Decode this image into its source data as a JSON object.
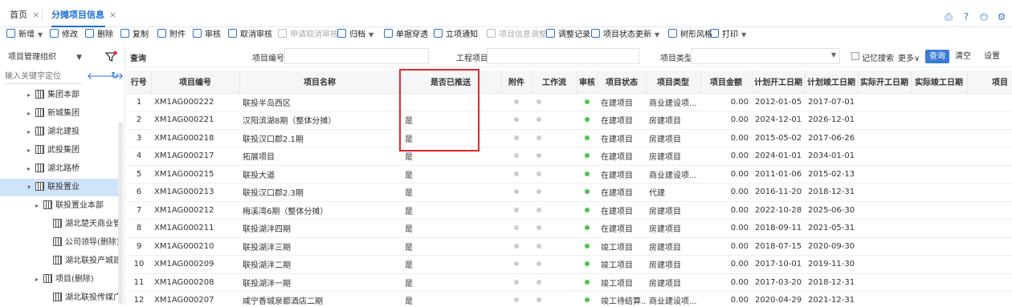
{
  "tabs": [
    {
      "label": "首页",
      "close": "×"
    },
    {
      "label": "分摊项目信息",
      "close": "×"
    }
  ],
  "toolbar": [
    {
      "label": "新增",
      "caret": true,
      "disabled": false
    },
    {
      "label": "修改",
      "disabled": false
    },
    {
      "label": "删除",
      "disabled": false
    },
    {
      "label": "复制",
      "disabled": false
    },
    {
      "label": "附件",
      "disabled": false
    },
    {
      "label": "审核",
      "disabled": false
    },
    {
      "label": "取消审核",
      "disabled": false
    },
    {
      "label": "申请取消审核",
      "disabled": true
    },
    {
      "label": "归档",
      "caret": true,
      "disabled": false
    },
    {
      "label": "单据穿透",
      "disabled": false
    },
    {
      "label": "立项通知",
      "disabled": false
    },
    {
      "label": "项目信息调整",
      "disabled": true
    },
    {
      "label": "调整记录",
      "disabled": false
    },
    {
      "label": "项目状态更新",
      "caret": true,
      "disabled": false
    },
    {
      "label": "树形风格",
      "disabled": false
    },
    {
      "label": "打印",
      "caret": true,
      "disabled": false
    }
  ],
  "left": {
    "select_value": "项目管理组织",
    "search_placeholder": "输入关键字定位",
    "tree": [
      {
        "label": "集团本部",
        "level": 1,
        "arrow": "▸",
        "selected": false
      },
      {
        "label": "新城集团",
        "level": 1,
        "arrow": "▸",
        "selected": false
      },
      {
        "label": "湖北建投",
        "level": 1,
        "arrow": "▸",
        "selected": false
      },
      {
        "label": "武投集团",
        "level": 1,
        "arrow": "▸",
        "selected": false
      },
      {
        "label": "湖北路桥",
        "level": 1,
        "arrow": "▸",
        "selected": false
      },
      {
        "label": "联投置业",
        "level": 1,
        "arrow": "▾",
        "selected": true
      },
      {
        "label": "联投置业本部",
        "level": 2,
        "arrow": "▸",
        "selected": false
      },
      {
        "label": "湖北楚天商业管理有限",
        "level": 3,
        "arrow": "",
        "selected": false
      },
      {
        "label": "公司领导(删除)",
        "level": 3,
        "arrow": "",
        "selected": false
      },
      {
        "label": "湖北联投产城建设发展",
        "level": 3,
        "arrow": "",
        "selected": false
      },
      {
        "label": "项目(删除)",
        "level": 2,
        "arrow": "▸",
        "selected": false
      },
      {
        "label": "湖北联投传媒广告有限",
        "level": 3,
        "arrow": "",
        "selected": false
      }
    ]
  },
  "search": {
    "query_label": "查询",
    "code_label": "项目编号:",
    "name_label": "工程项目:",
    "type_label": "项目类型:",
    "remember_label": "记忆搜索",
    "more_label": "更多∨",
    "query_btn": "查询",
    "clear_btn": "清空",
    "settings_btn": "设置"
  },
  "columns": [
    "行号",
    "项目编号",
    "项目名称",
    "是否已推送",
    "附件",
    "工作流",
    "审核",
    "项目状态",
    "项目类型",
    "项目金额",
    "计划开工日期",
    "计划竣工日期",
    "实际开工日期",
    "实际竣工日期",
    "项目"
  ],
  "rows": [
    {
      "no": "1",
      "code": "XM1AG000222",
      "name": "联投半岛西区",
      "pushed": "",
      "status": "在建项目",
      "type": "商业建设项...",
      "amount": "0.00",
      "ps": "2012-01-05",
      "pe": "2017-07-01"
    },
    {
      "no": "2",
      "code": "XM1AG000221",
      "name": "汉阳滨湖8期（整体分摊）",
      "pushed": "是",
      "status": "在建项目",
      "type": "房建项目",
      "amount": "0.00",
      "ps": "2024-12-01",
      "pe": "2026-12-01"
    },
    {
      "no": "3",
      "code": "XM1AG000218",
      "name": "联投汉口郡2.1期",
      "pushed": "是",
      "status": "在建项目",
      "type": "房建项目",
      "amount": "0.00",
      "ps": "2015-05-02",
      "pe": "2017-06-26"
    },
    {
      "no": "4",
      "code": "XM1AG000217",
      "name": "拓展项目",
      "pushed": "是",
      "status": "在建项目",
      "type": "房建项目",
      "amount": "0.00",
      "ps": "2024-01-01",
      "pe": "2034-01-01"
    },
    {
      "no": "5",
      "code": "XM1AG000215",
      "name": "联投大道",
      "pushed": "是",
      "status": "在建项目",
      "type": "商业建设项...",
      "amount": "0.00",
      "ps": "2011-01-06",
      "pe": "2015-02-13"
    },
    {
      "no": "6",
      "code": "XM1AG000213",
      "name": "联投汉口郡2.3期",
      "pushed": "是",
      "status": "在建项目",
      "type": "代建",
      "amount": "0.00",
      "ps": "2016-11-20",
      "pe": "2018-12-31"
    },
    {
      "no": "7",
      "code": "XM1AG000212",
      "name": "梅溪湾6期（整体分摊）",
      "pushed": "是",
      "status": "在建项目",
      "type": "房建项目",
      "amount": "0.00",
      "ps": "2022-10-28",
      "pe": "2025-06-30"
    },
    {
      "no": "8",
      "code": "XM1AG000211",
      "name": "联投湖泮四期",
      "pushed": "是",
      "status": "在建项目",
      "type": "房建项目",
      "amount": "0.00",
      "ps": "2018-09-11",
      "pe": "2021-05-31"
    },
    {
      "no": "9",
      "code": "XM1AG000210",
      "name": "联投湖泮三期",
      "pushed": "是",
      "status": "竣工项目",
      "type": "房建项目",
      "amount": "0.00",
      "ps": "2018-07-15",
      "pe": "2020-09-30"
    },
    {
      "no": "10",
      "code": "XM1AG000209",
      "name": "联投湖泮二期",
      "pushed": "是",
      "status": "竣工项目",
      "type": "房建项目",
      "amount": "0.00",
      "ps": "2017-10-01",
      "pe": "2019-11-30"
    },
    {
      "no": "11",
      "code": "XM1AG000208",
      "name": "联投湖泮一期",
      "pushed": "是",
      "status": "竣工项目",
      "type": "房建项目",
      "amount": "0.00",
      "ps": "2017-03-20",
      "pe": "2018-12-31"
    },
    {
      "no": "12",
      "code": "XM1AG000207",
      "name": "咸宁香城泉都酒店二期",
      "pushed": "是",
      "status": "竣工待结算...",
      "type": "商业建设项...",
      "amount": "0.00",
      "ps": "2020-04-29",
      "pe": "2021-12-31"
    }
  ]
}
